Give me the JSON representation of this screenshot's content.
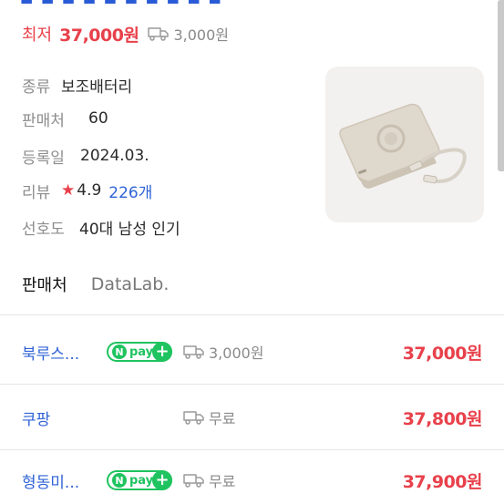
{
  "price_summary": {
    "label": "최저",
    "price": "37,000원",
    "shipping": "3,000원"
  },
  "specs": [
    {
      "key": "종류",
      "value": "보조배터리"
    },
    {
      "key": "판매처",
      "value": "60"
    },
    {
      "key": "등록일",
      "value": "2024.03."
    },
    {
      "key": "리뷰",
      "rating": "4.9",
      "reviews": "226개"
    },
    {
      "key": "선호도",
      "value": "40대 남성 인기"
    }
  ],
  "tabs": [
    "판매처",
    "DataLab."
  ],
  "sellers": [
    {
      "name": "북루스...",
      "npay": true,
      "shipping": "3,000원",
      "price": "37,000원"
    },
    {
      "name": "쿠팡",
      "npay": false,
      "shipping": "무료",
      "price": "37,800원"
    },
    {
      "name": "형동미...",
      "npay": true,
      "shipping": "무료",
      "price": "37,900원"
    }
  ],
  "npay_label": {
    "n": "N",
    "pay": "pay",
    "plus": "+"
  },
  "icons": {
    "shipping": "truck-icon",
    "rating": "star-icon",
    "product": "battery-product-image"
  },
  "colors": {
    "accent_red": "#e8414b",
    "link_blue": "#2f63d6",
    "npay_green": "#1fc35f"
  }
}
